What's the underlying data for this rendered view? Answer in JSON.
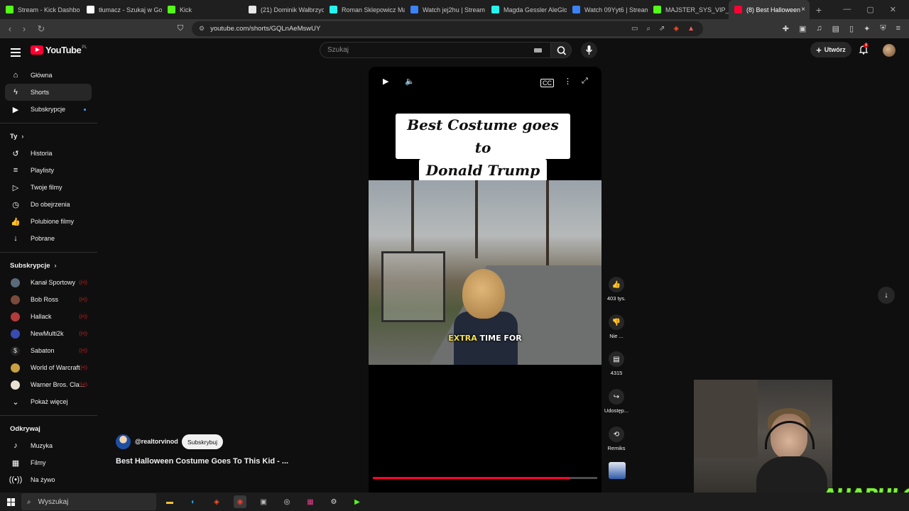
{
  "browser": {
    "tabs": [
      {
        "title": "Stream - Kick Dashbo",
        "color": "#53fc18"
      },
      {
        "title": "tłumacz - Szukaj w Go",
        "color": "#ffffff"
      },
      {
        "title": "Kick",
        "color": "#53fc18"
      },
      {
        "title": "(21) Dominik Wałbrzyc",
        "color": "#e7e7e7"
      },
      {
        "title": "Roman Sklepowicz Ma",
        "color": "#25f4ee"
      },
      {
        "title": "Watch jej2hu | Stream",
        "color": "#3b82f6"
      },
      {
        "title": "Magda Gessler AleGlor",
        "color": "#25f4ee"
      },
      {
        "title": "Watch 09Yyt6 | Stream",
        "color": "#3b82f6"
      },
      {
        "title": "MAJSTER_SYS_VIP_C S",
        "color": "#53fc18"
      },
      {
        "title": "(8) Best Halloween",
        "color": "#ff0033",
        "active": true,
        "close": "×"
      }
    ],
    "newtab": "+",
    "url": "youtube.com/shorts/GQLnAeMswUY"
  },
  "youtube": {
    "logo_text": "YouTube",
    "region": "PL",
    "search_placeholder": "Szukaj",
    "create_label": "Utwórz",
    "notif_count": "8",
    "sidebar": {
      "main": [
        {
          "label": "Główna",
          "icon": "⌂",
          "name": "home"
        },
        {
          "label": "Shorts",
          "icon": "ϟ",
          "name": "shorts",
          "active": true
        },
        {
          "label": "Subskrypcje",
          "icon": "▶",
          "name": "subscriptions",
          "dot": true
        }
      ],
      "you_header": "Ty",
      "you": [
        {
          "label": "Historia",
          "icon": "↺",
          "name": "history"
        },
        {
          "label": "Playlisty",
          "icon": "≡",
          "name": "playlists"
        },
        {
          "label": "Twoje filmy",
          "icon": "▷",
          "name": "your-videos"
        },
        {
          "label": "Do obejrzenia",
          "icon": "◷",
          "name": "watch-later"
        },
        {
          "label": "Polubione filmy",
          "icon": "👍",
          "name": "liked-videos"
        },
        {
          "label": "Pobrane",
          "icon": "↓",
          "name": "downloads"
        }
      ],
      "subs_header": "Subskrypcje",
      "subs": [
        {
          "label": "Kanał Sportowy",
          "color": "#5a6a7a"
        },
        {
          "label": "Bob Ross",
          "color": "#7a4a3a"
        },
        {
          "label": "Hallack",
          "color": "#b33a3a"
        },
        {
          "label": "NewMulti2k",
          "color": "#3a4ab3"
        },
        {
          "label": "Sabaton",
          "color": "#222222",
          "glyph": "$"
        },
        {
          "label": "World of Warcraft",
          "color": "#c8a040"
        },
        {
          "label": "Warner Bros. Cla...",
          "color": "#e8e0d0"
        }
      ],
      "show_more": "Pokaż więcej",
      "explore_header": "Odkrywaj",
      "explore": [
        {
          "label": "Muzyka",
          "icon": "♪",
          "name": "music"
        },
        {
          "label": "Filmy",
          "icon": "▦",
          "name": "movies"
        },
        {
          "label": "Na żywo",
          "icon": "((•))",
          "name": "live"
        }
      ]
    },
    "short": {
      "overlay_line1": "Best Costume goes to",
      "overlay_line2": "Donald Trump",
      "subtitle_highlight": "EXTRA",
      "subtitle_rest": " TIME FOR",
      "progress": 0.88,
      "channel": "@realtorvinod",
      "subscribe_label": "Subskrybuj",
      "title": "Best Halloween Costume Goes To This Kid - ..."
    },
    "actions": {
      "likes": "403 tys.",
      "dislike": "Nie ...",
      "comments": "4315",
      "share": "Udostęp...",
      "remix": "Remiks"
    }
  },
  "overlay": {
    "brand": "AHAPULCO"
  },
  "taskbar": {
    "search_placeholder": "Wyszukaj"
  }
}
